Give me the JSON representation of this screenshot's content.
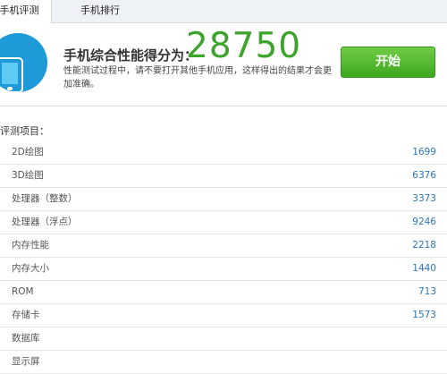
{
  "tabs": [
    {
      "label": "手机评测",
      "active": true
    },
    {
      "label": "手机排行",
      "active": false
    }
  ],
  "header": {
    "icon": "smartphone-icon",
    "score_label": "手机综合性能得分为：",
    "score_value": "28750",
    "score_color": "#3ba42a",
    "description": "性能测试过程中，请不要打开其他手机应用，这样得出的结果才会更加准确。",
    "start_label": "开始",
    "accent_color": "#1e9ad8"
  },
  "list": {
    "title": "评测项目：",
    "items": [
      {
        "name": "2D绘图",
        "value": "1699"
      },
      {
        "name": "3D绘图",
        "value": "6376"
      },
      {
        "name": "处理器（整数）",
        "value": "3373"
      },
      {
        "name": "处理器（浮点）",
        "value": "9246"
      },
      {
        "name": "内存性能",
        "value": "2218"
      },
      {
        "name": "内存大小",
        "value": "1440"
      },
      {
        "name": "ROM",
        "value": "713"
      },
      {
        "name": "存储卡",
        "value": "1573"
      },
      {
        "name": "数据库",
        "value": ""
      },
      {
        "name": "显示屏",
        "value": ""
      }
    ]
  }
}
